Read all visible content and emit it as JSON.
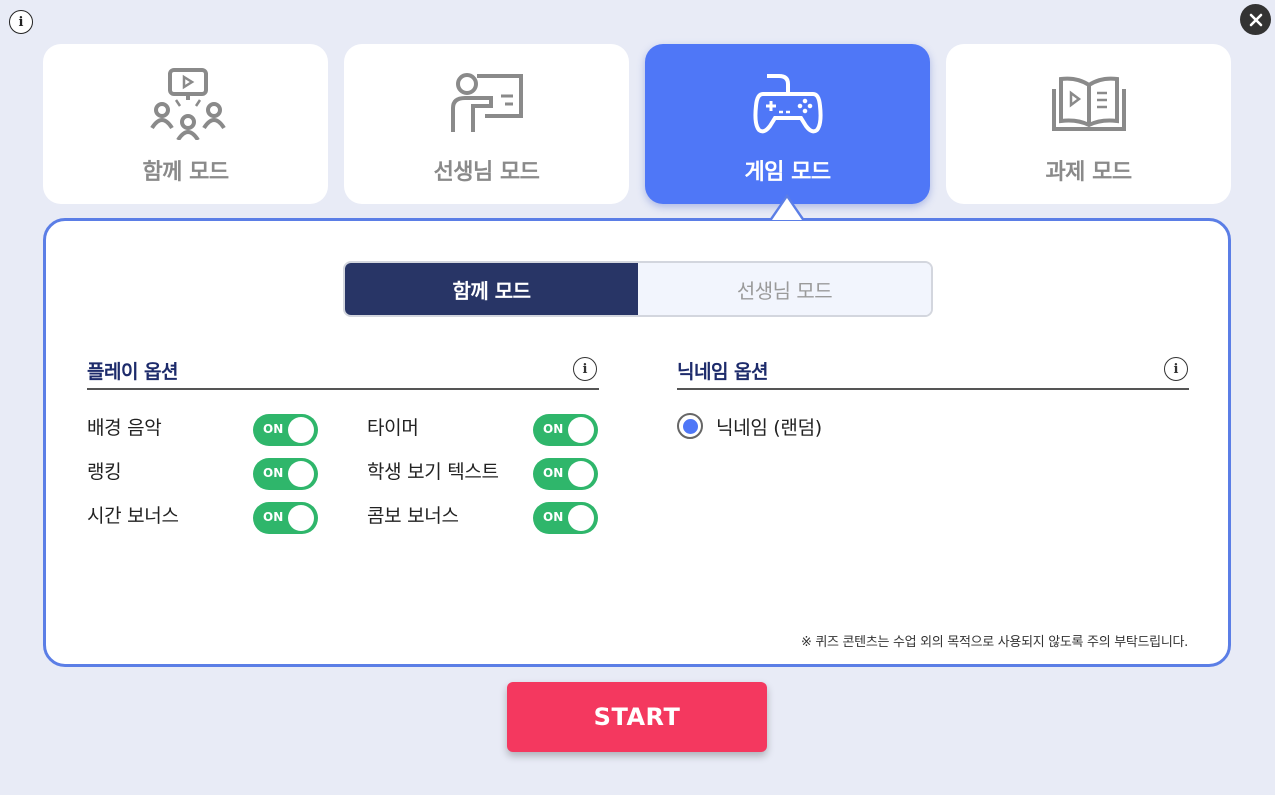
{
  "top": {
    "info_icon": "info-icon",
    "close_icon": "close-icon",
    "info_glyph": "i"
  },
  "modes": [
    {
      "label": "함께 모드",
      "icon": "audience-screen-icon",
      "active": false
    },
    {
      "label": "선생님 모드",
      "icon": "teacher-board-icon",
      "active": false
    },
    {
      "label": "게임 모드",
      "icon": "gamepad-icon",
      "active": true
    },
    {
      "label": "과제 모드",
      "icon": "open-book-icon",
      "active": false
    }
  ],
  "panel": {
    "segment": {
      "left": "함께 모드",
      "right": "선생님 모드",
      "selected": "함께 모드"
    },
    "play_options": {
      "title": "플레이 옵션",
      "items": [
        {
          "label": "배경 음악",
          "state": "ON"
        },
        {
          "label": "타이머",
          "state": "ON"
        },
        {
          "label": "랭킹",
          "state": "ON"
        },
        {
          "label": "학생 보기 텍스트",
          "state": "ON"
        },
        {
          "label": "시간 보너스",
          "state": "ON"
        },
        {
          "label": "콤보 보너스",
          "state": "ON"
        }
      ]
    },
    "nickname_options": {
      "title": "닉네임 옵션",
      "choice": "닉네임 (랜덤)"
    },
    "notice": "※ 퀴즈 콘텐츠는 수업 외의 목적으로 사용되지 않도록 주의 부탁드립니다."
  },
  "start_label": "START",
  "colors": {
    "accent": "#4f77f7",
    "dark_navy": "#283566",
    "toggle_green": "#2fb66b",
    "start_red": "#f4385f"
  }
}
